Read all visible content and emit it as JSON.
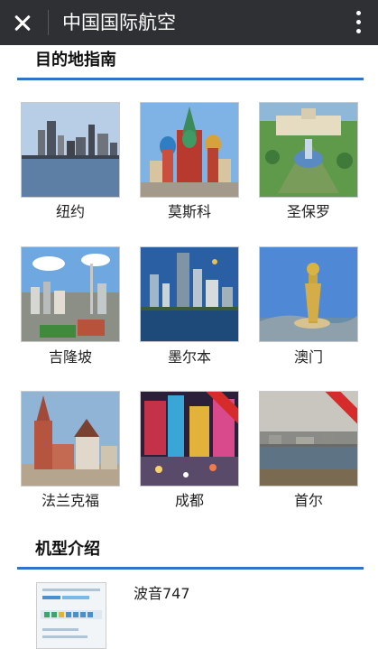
{
  "header": {
    "title": "中国国际航空",
    "close_icon": "close-icon",
    "menu_icon": "more-vertical-icon"
  },
  "destinations": {
    "title": "目的地指南",
    "cities": [
      {
        "name": "纽约"
      },
      {
        "name": "莫斯科"
      },
      {
        "name": "圣保罗"
      },
      {
        "name": "吉隆坡"
      },
      {
        "name": "墨尔本"
      },
      {
        "name": "澳门"
      },
      {
        "name": "法兰克福"
      },
      {
        "name": "成都"
      },
      {
        "name": "首尔"
      }
    ]
  },
  "aircraft": {
    "title": "机型介绍",
    "items": [
      {
        "name": "波音747"
      }
    ]
  },
  "colors": {
    "topbar": "#2e3034",
    "accent_line": "#2f74c9",
    "badge": "#d62b2b"
  }
}
